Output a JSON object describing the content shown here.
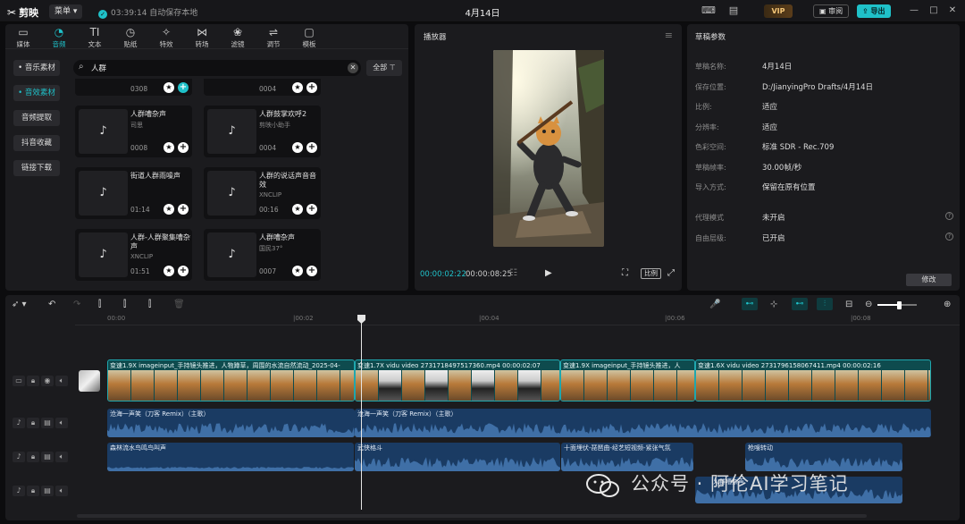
{
  "app": {
    "logo": "剪映",
    "menu": "菜单",
    "save_status": "03:39:14 自动保存本地",
    "project_title": "4月14日",
    "vip": "VIP",
    "review": "审阅",
    "export": "导出"
  },
  "media_tabs": [
    {
      "label": "媒体",
      "icon": "media-icon"
    },
    {
      "label": "音频",
      "icon": "audio-icon"
    },
    {
      "label": "文本",
      "icon": "text-icon"
    },
    {
      "label": "贴纸",
      "icon": "sticker-icon"
    },
    {
      "label": "特效",
      "icon": "effects-icon"
    },
    {
      "label": "转场",
      "icon": "transition-icon"
    },
    {
      "label": "滤镜",
      "icon": "filter-icon"
    },
    {
      "label": "调节",
      "icon": "adjust-icon"
    },
    {
      "label": "模板",
      "icon": "template-icon"
    }
  ],
  "audio_sidebar": [
    {
      "label": "• 音乐素材"
    },
    {
      "label": "• 音效素材"
    },
    {
      "label": "音频提取"
    },
    {
      "label": "抖音收藏"
    },
    {
      "label": "链接下载"
    }
  ],
  "search": {
    "value": "人群",
    "filter_label": "全部"
  },
  "sound_cards": [
    {
      "title": "",
      "author": "",
      "duration": "0308"
    },
    {
      "title": "",
      "author": "",
      "duration": "0004"
    },
    {
      "title": "人群嘈杂声",
      "author": "司思",
      "duration": "0008"
    },
    {
      "title": "人群鼓掌欢呼2",
      "author": "剪映小助手",
      "duration": "0004"
    },
    {
      "title": "街道人群雨噪声",
      "author": "",
      "duration": "01:14"
    },
    {
      "title": "人群的说话声音音效",
      "author": "XNCLIP",
      "duration": "00:16"
    },
    {
      "title": "人群-人群聚集嘈杂声",
      "author": "XNCLIP",
      "duration": "01:51"
    },
    {
      "title": "人群嘈杂声",
      "author": "国民37°",
      "duration": "0007"
    }
  ],
  "player": {
    "title": "播放器",
    "current_time": "00:00:02:22",
    "total_time": "00:00:08:25",
    "ratio": "比例"
  },
  "params": {
    "title": "草稿参数",
    "rows": [
      {
        "label": "草稿名称:",
        "value": "4月14日"
      },
      {
        "label": "保存位置:",
        "value": "D:/JianyingPro Drafts/4月14日"
      },
      {
        "label": "比例:",
        "value": "适应"
      },
      {
        "label": "分辨率:",
        "value": "适应"
      },
      {
        "label": "色彩空间:",
        "value": "标准 SDR - Rec.709"
      },
      {
        "label": "草稿帧率:",
        "value": "30.00帧/秒"
      },
      {
        "label": "导入方式:",
        "value": "保留在原有位置"
      },
      {
        "label": "代理模式",
        "value": "未开启"
      },
      {
        "label": "自由层级:",
        "value": "已开启"
      }
    ],
    "modify": "修改"
  },
  "ruler": [
    "00:00",
    "|00:02",
    "|00:04",
    "|00:06",
    "|00:08"
  ],
  "video_clips": [
    {
      "caption": "变速1.9X  imageinput_手持镜头推进，人物蹲草，周围的水流自然流动_2025-04-",
      "duration": ""
    },
    {
      "caption": "变速1.7X  vidu video  2731718497517360.mp4  00:00:02:07",
      "duration": ""
    },
    {
      "caption": "变速1.9X  imageinput_手持镜头推进，人",
      "duration": ""
    },
    {
      "caption": "变速1.6X  vidu video  2731796158067411.mp4  00:00:02:16",
      "duration": ""
    }
  ],
  "music_clips": [
    {
      "caption": "沧海一声笑（刀客 Remix）（主歌）"
    },
    {
      "caption": "沧海一声笑（刀客 Remix）（主歌）"
    }
  ],
  "sfx_clips": [
    {
      "caption": "森林流水鸟鸣鸟叫声"
    },
    {
      "caption": "武侠格斗"
    },
    {
      "caption": "十面埋伏-琵琶曲-经艺短视频-紧张气氛"
    },
    {
      "caption": "枪嗖转动"
    }
  ],
  "sfx2_clips": [
    {
      "caption": "人群嘈杂声"
    }
  ],
  "watermark": "公众号 · 阿伦AI学习笔记",
  "colors": {
    "accent": "#1fc1c9",
    "video_clip": "#0e4b4e",
    "audio_clip": "#1a3b63"
  }
}
